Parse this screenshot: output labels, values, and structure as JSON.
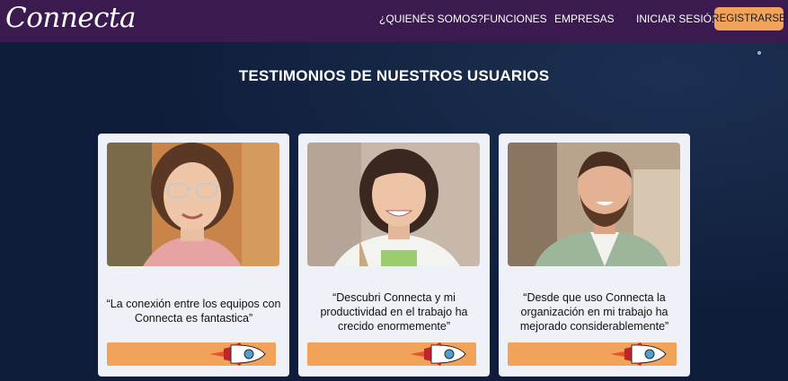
{
  "nav": {
    "logo": "Connecta",
    "links": [
      "¿QUIENÉS SOMOS?",
      "FUNCIONES",
      "EMPRESAS"
    ],
    "login": "INICIAR SESIÓN",
    "register": "REGISTRARSE"
  },
  "section": {
    "title": "TESTIMONIOS DE NUESTROS USUARIOS"
  },
  "testimonials": [
    {
      "quote": "“La conexión entre los equipos con Connecta es fantastica”"
    },
    {
      "quote": "“Descubri Connecta y mi productividad en el trabajo ha crecido enormemente”"
    },
    {
      "quote": "“Desde que uso Connecta la organización en mi trabajo ha mejorado considerablemente”"
    }
  ],
  "colors": {
    "navbar": "#3a1a4f",
    "background": "#0f1d3a",
    "accent": "#f2a35a",
    "card": "#eef1f7"
  },
  "icons": [
    "rocket-icon"
  ]
}
